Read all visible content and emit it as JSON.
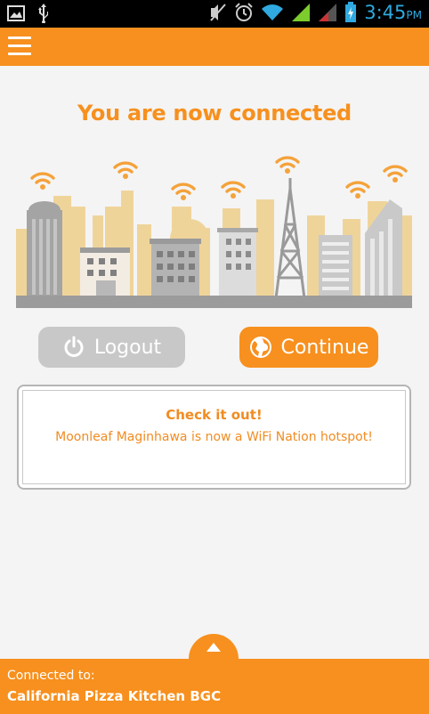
{
  "status_bar": {
    "time": "3:45",
    "ampm": "PM",
    "icons": [
      "picture-icon",
      "usb-icon",
      "mute-icon",
      "alarm-icon",
      "wifi-icon",
      "signal-icon",
      "signal-icon",
      "battery-charging-icon"
    ]
  },
  "app_bar": {
    "menu_icon": "hamburger-menu-icon",
    "color": "#f7901e"
  },
  "main": {
    "title": "You are now connected",
    "illustration": "city-skyline-wifi-illustration"
  },
  "actions": {
    "logout_label": "Logout",
    "logout_icon": "power-icon",
    "continue_label": "Continue",
    "continue_icon": "globe-icon"
  },
  "notice": {
    "title": "Check it out!",
    "message": "Moonleaf Maginhawa is now a WiFi Nation hotspot!"
  },
  "footer": {
    "expand_icon": "chevron-up-icon",
    "connected_label": "Connected to:",
    "network_name": "California Pizza Kitchen BGC"
  },
  "colors": {
    "accent": "#f7901e",
    "button_disabled": "#c8c8c8",
    "status_time": "#2fa9e0"
  }
}
